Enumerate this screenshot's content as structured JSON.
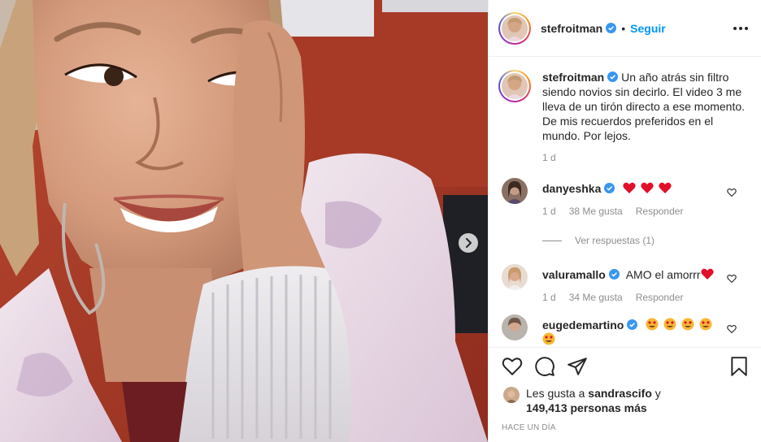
{
  "header": {
    "username": "stefroitman",
    "separator": "•",
    "follow_label": "Seguir"
  },
  "caption": {
    "username": "stefroitman",
    "text": "Un año atrás sin filtro siendo novios sin decirlo. El video 3 me lleva de un tirón directo a ese momento. De mis recuerdos preferidos en el mundo. Por lejos.",
    "time": "1 d"
  },
  "comments": [
    {
      "username": "danyeshka",
      "text": "",
      "emoji": "heart-emoji x3",
      "time": "1 d",
      "likes": "38 Me gusta",
      "reply_label": "Responder",
      "view_replies": "Ver respuestas (1)"
    },
    {
      "username": "valuramallo",
      "text": "AMO el amorrr",
      "emoji": "heart-emoji",
      "time": "1 d",
      "likes": "34 Me gusta",
      "reply_label": "Responder"
    },
    {
      "username": "eugedemartino",
      "text": "",
      "emoji": "heart-eyes-emoji x5"
    }
  ],
  "likes": {
    "prefix": "Les gusta a",
    "user": "sandrascifo",
    "connector": "y",
    "count": "149,413 personas más"
  },
  "posted": "Hace un día",
  "colors": {
    "accent": "#0095f6",
    "verified": "#3897f0",
    "muted": "#8e8e8e",
    "emoji_heart": "#e0102b"
  },
  "icons": [
    "verified-icon",
    "more-icon",
    "heart-icon",
    "comment-icon",
    "share-icon",
    "save-icon",
    "next-arrow-icon"
  ]
}
